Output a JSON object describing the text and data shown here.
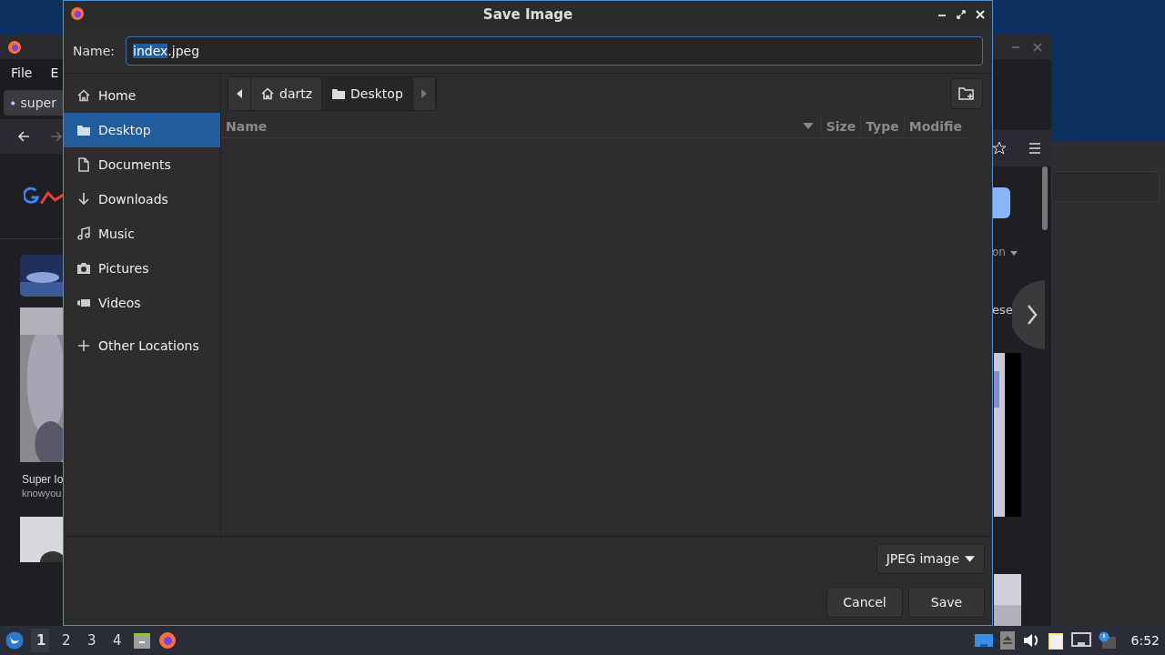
{
  "background": {
    "browser_menu": [
      "File",
      "E"
    ],
    "browser_tab": "super",
    "video_title": "Super Io",
    "video_channel": "knowyou",
    "right_texts": [
      "on",
      "ese"
    ]
  },
  "dialog": {
    "title": "Save Image",
    "name_label": "Name:",
    "file_name_selected": "index",
    "file_name_rest": ".jpeg",
    "places": [
      {
        "label": "Home",
        "kind": "home",
        "selected": false
      },
      {
        "label": "Desktop",
        "kind": "folder",
        "selected": true
      },
      {
        "label": "Documents",
        "kind": "document",
        "selected": false
      },
      {
        "label": "Downloads",
        "kind": "download",
        "selected": false
      },
      {
        "label": "Music",
        "kind": "music",
        "selected": false
      },
      {
        "label": "Pictures",
        "kind": "camera",
        "selected": false
      },
      {
        "label": "Videos",
        "kind": "video",
        "selected": false
      }
    ],
    "other_locations": "Other Locations",
    "path": [
      {
        "label": "dartz",
        "kind": "home",
        "selected": false
      },
      {
        "label": "Desktop",
        "kind": "folder",
        "selected": true
      }
    ],
    "columns": [
      "Name",
      "Size",
      "Type",
      "Modifie"
    ],
    "file_type": "JPEG image",
    "buttons": [
      "Cancel",
      "Save"
    ]
  },
  "taskbar": {
    "workspaces": [
      {
        "label": "1",
        "selected": true
      },
      {
        "label": "2",
        "selected": false
      },
      {
        "label": "3",
        "selected": false
      },
      {
        "label": "4",
        "selected": false
      }
    ],
    "clock": "6:52"
  }
}
